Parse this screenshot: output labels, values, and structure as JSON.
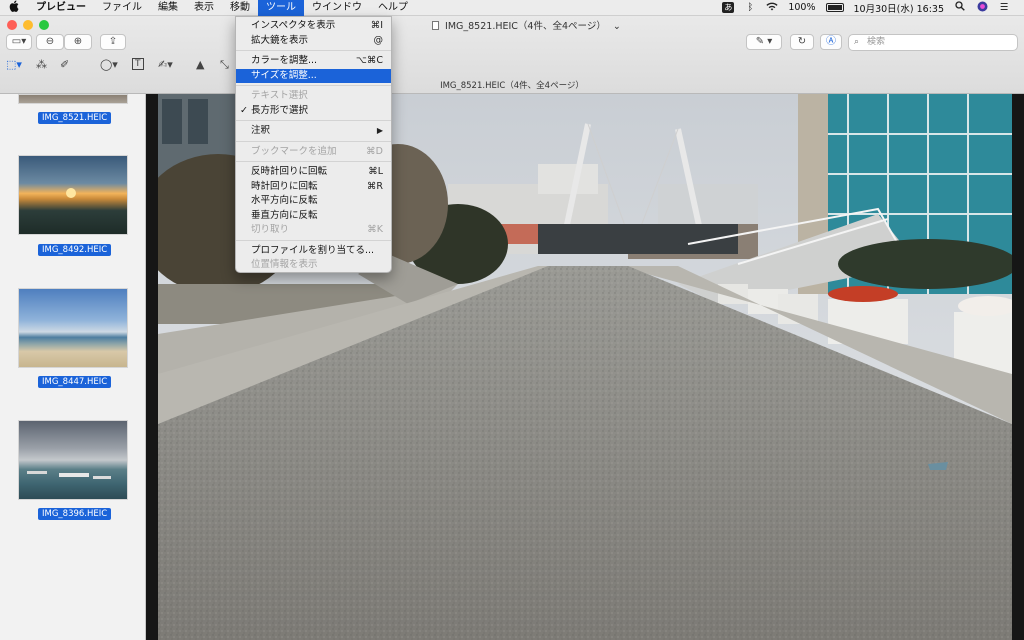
{
  "menubar": {
    "apple": "",
    "items": [
      "プレビュー",
      "ファイル",
      "編集",
      "表示",
      "移動",
      "ツール",
      "ウインドウ",
      "ヘルプ"
    ],
    "active_index": 5,
    "status": {
      "battery_pct": "100%",
      "datetime": "10月30日(水)  16:35"
    }
  },
  "window": {
    "title": "IMG_8521.HEIC（4件、全4ページ）",
    "path_title": "IMG_8521.HEIC（4件、全4ページ）",
    "search_placeholder": "検索"
  },
  "sidebar": {
    "thumbnails": [
      {
        "label": "IMG_8521.HEIC"
      },
      {
        "label": "IMG_8492.HEIC"
      },
      {
        "label": "IMG_8447.HEIC"
      },
      {
        "label": "IMG_8396.HEIC"
      }
    ]
  },
  "tools_menu": {
    "items": [
      {
        "label": "インスペクタを表示",
        "shortcut": "⌘I"
      },
      {
        "label": "拡大鏡を表示",
        "shortcut": "@"
      },
      {
        "label": "カラーを調整...",
        "shortcut": "⌥⌘C"
      },
      {
        "label": "サイズを調整...",
        "shortcut": ""
      },
      {
        "label": "テキスト選択",
        "shortcut": ""
      },
      {
        "label": "長方形で選択",
        "shortcut": "",
        "checked": "✓"
      },
      {
        "label": "注釈",
        "shortcut": "▶"
      },
      {
        "label": "ブックマークを追加",
        "shortcut": "⌘D"
      },
      {
        "label": "反時計回りに回転",
        "shortcut": "⌘L"
      },
      {
        "label": "時計回りに回転",
        "shortcut": "⌘R"
      },
      {
        "label": "水平方向に反転",
        "shortcut": ""
      },
      {
        "label": "垂直方向に反転",
        "shortcut": ""
      },
      {
        "label": "切り取り",
        "shortcut": "⌘K"
      },
      {
        "label": "プロファイルを割り当てる...",
        "shortcut": ""
      },
      {
        "label": "位置情報を表示",
        "shortcut": ""
      }
    ]
  },
  "colors": {
    "accent": "#1b63d9",
    "menu_bg": "#ececec"
  }
}
